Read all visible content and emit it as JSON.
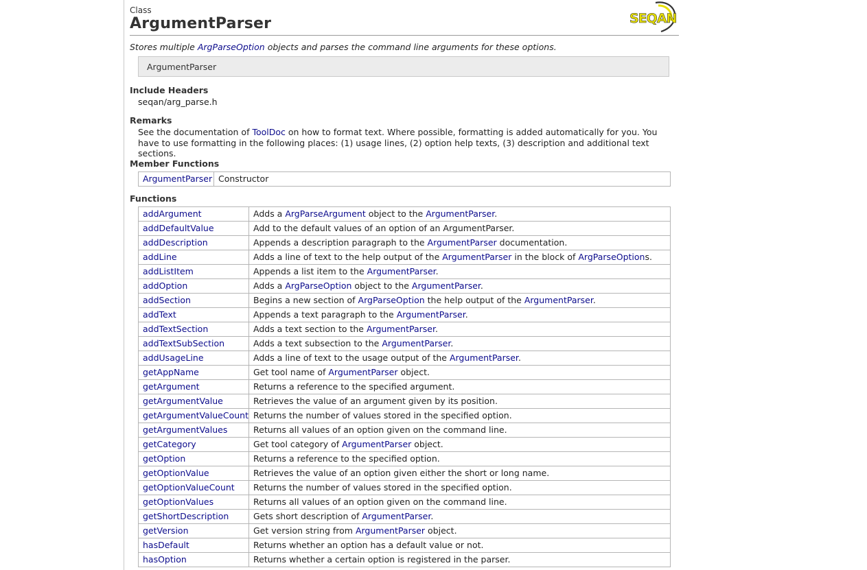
{
  "header": {
    "kind": "Class",
    "title": "ArgumentParser",
    "logo_text": "SEQAN"
  },
  "summary": {
    "prefix": "Stores multiple ",
    "link": "ArgParseOption",
    "suffix": " objects and parses the command line arguments for these options."
  },
  "signature": "ArgumentParser",
  "include_headers": {
    "heading": "Include Headers",
    "value": "seqan/arg_parse.h"
  },
  "remarks": {
    "heading": "Remarks",
    "prefix": "See the documentation of ",
    "link": "ToolDoc",
    "suffix": " on how to format text. Where possible, formatting is added automatically for you. You have to use formatting in the following places: (1) usage lines, (2) option help texts, (3) description and additional text sections."
  },
  "member_functions": {
    "heading": "Member Functions",
    "rows": [
      {
        "name": "ArgumentParser",
        "desc": [
          {
            "t": "Constructor"
          }
        ]
      }
    ]
  },
  "functions": {
    "heading": "Functions",
    "rows": [
      {
        "name": "addArgument",
        "desc": [
          {
            "t": "Adds a "
          },
          {
            "l": "ArgParseArgument"
          },
          {
            "t": " object to the "
          },
          {
            "l": "ArgumentParser"
          },
          {
            "t": "."
          }
        ]
      },
      {
        "name": "addDefaultValue",
        "desc": [
          {
            "t": "Add to the default values of an option of an ArgumentParser."
          }
        ]
      },
      {
        "name": "addDescription",
        "desc": [
          {
            "t": "Appends a description paragraph to the "
          },
          {
            "l": "ArgumentParser"
          },
          {
            "t": " documentation."
          }
        ]
      },
      {
        "name": "addLine",
        "desc": [
          {
            "t": "Adds a line of text to the help output of the "
          },
          {
            "l": "ArgumentParser"
          },
          {
            "t": " in the block of "
          },
          {
            "l": "ArgParseOption"
          },
          {
            "t": "s."
          }
        ]
      },
      {
        "name": "addListItem",
        "desc": [
          {
            "t": "Appends a list item to the "
          },
          {
            "l": "ArgumentParser"
          },
          {
            "t": "."
          }
        ]
      },
      {
        "name": "addOption",
        "desc": [
          {
            "t": "Adds a "
          },
          {
            "l": "ArgParseOption"
          },
          {
            "t": " object to the "
          },
          {
            "l": "ArgumentParser"
          },
          {
            "t": "."
          }
        ]
      },
      {
        "name": "addSection",
        "desc": [
          {
            "t": "Begins a new section of "
          },
          {
            "l": "ArgParseOption"
          },
          {
            "t": " the help output of the "
          },
          {
            "l": "ArgumentParser"
          },
          {
            "t": "."
          }
        ]
      },
      {
        "name": "addText",
        "desc": [
          {
            "t": "Appends a text paragraph to the "
          },
          {
            "l": "ArgumentParser"
          },
          {
            "t": "."
          }
        ]
      },
      {
        "name": "addTextSection",
        "desc": [
          {
            "t": "Adds a text section to the "
          },
          {
            "l": "ArgumentParser"
          },
          {
            "t": "."
          }
        ]
      },
      {
        "name": "addTextSubSection",
        "desc": [
          {
            "t": "Adds a text subsection to the "
          },
          {
            "l": "ArgumentParser"
          },
          {
            "t": "."
          }
        ]
      },
      {
        "name": "addUsageLine",
        "desc": [
          {
            "t": "Adds a line of text to the usage output of the "
          },
          {
            "l": "ArgumentParser"
          },
          {
            "t": "."
          }
        ]
      },
      {
        "name": "getAppName",
        "desc": [
          {
            "t": "Get tool name of "
          },
          {
            "l": "ArgumentParser"
          },
          {
            "t": " object."
          }
        ]
      },
      {
        "name": "getArgument",
        "desc": [
          {
            "t": "Returns a reference to the specified argument."
          }
        ]
      },
      {
        "name": "getArgumentValue",
        "desc": [
          {
            "t": "Retrieves the value of an argument given by its position."
          }
        ]
      },
      {
        "name": "getArgumentValueCount",
        "desc": [
          {
            "t": "Returns the number of values stored in the specified option."
          }
        ]
      },
      {
        "name": "getArgumentValues",
        "desc": [
          {
            "t": "Returns all values of an option given on the command line."
          }
        ]
      },
      {
        "name": "getCategory",
        "desc": [
          {
            "t": "Get tool category of "
          },
          {
            "l": "ArgumentParser"
          },
          {
            "t": " object."
          }
        ]
      },
      {
        "name": "getOption",
        "desc": [
          {
            "t": "Returns a reference to the specified option."
          }
        ]
      },
      {
        "name": "getOptionValue",
        "desc": [
          {
            "t": "Retrieves the value of an option given either the short or long name."
          }
        ]
      },
      {
        "name": "getOptionValueCount",
        "desc": [
          {
            "t": "Returns the number of values stored in the specified option."
          }
        ]
      },
      {
        "name": "getOptionValues",
        "desc": [
          {
            "t": "Returns all values of an option given on the command line."
          }
        ]
      },
      {
        "name": "getShortDescription",
        "desc": [
          {
            "t": "Gets short description of "
          },
          {
            "l": "ArgumentParser"
          },
          {
            "t": "."
          }
        ]
      },
      {
        "name": "getVersion",
        "desc": [
          {
            "t": "Get version string from "
          },
          {
            "l": "ArgumentParser"
          },
          {
            "t": " object."
          }
        ]
      },
      {
        "name": "hasDefault",
        "desc": [
          {
            "t": "Returns whether an option has a default value or not."
          }
        ]
      },
      {
        "name": "hasOption",
        "desc": [
          {
            "t": "Returns whether a certain option is registered in the parser."
          }
        ]
      }
    ]
  },
  "colors": {
    "link": "#0c0c8c",
    "logo_yellow": "#e8e000",
    "logo_dark": "#333333"
  }
}
